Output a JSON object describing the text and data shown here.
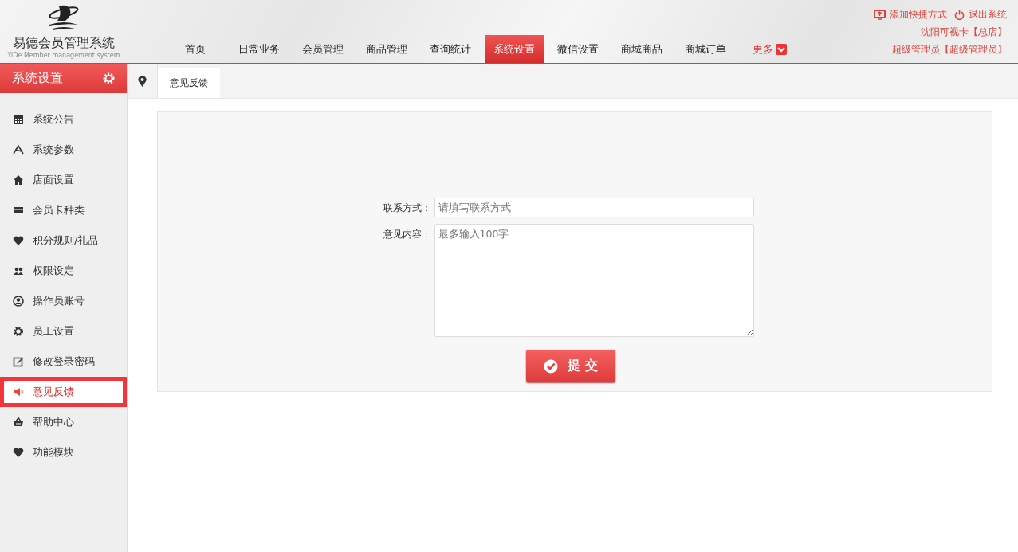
{
  "header": {
    "logo_title": "易德会员管理系统",
    "logo_subtitle": "YiDe Member management system",
    "nav": [
      {
        "label": "首页",
        "kind": "link",
        "selected": false
      },
      {
        "label": "日常业务",
        "kind": "link",
        "selected": false
      },
      {
        "label": "会员管理",
        "kind": "link",
        "selected": false
      },
      {
        "label": "商品管理",
        "kind": "link",
        "selected": false
      },
      {
        "label": "查询统计",
        "kind": "link",
        "selected": false
      },
      {
        "label": "系统设置",
        "kind": "link",
        "selected": true
      },
      {
        "label": "微信设置",
        "kind": "link",
        "selected": false
      },
      {
        "label": "商城商品",
        "kind": "link",
        "selected": false
      },
      {
        "label": "商城订单",
        "kind": "link",
        "selected": false
      },
      {
        "label": "更多",
        "kind": "more",
        "selected": false
      }
    ],
    "links": [
      {
        "label": "添加快捷方式",
        "kind": "shortcut"
      },
      {
        "label": "退出系统",
        "kind": "logout"
      }
    ],
    "shop": "沈阳可视卡【总店】",
    "user": "超级管理员【超级管理员】"
  },
  "sidebar": {
    "title": "系统设置",
    "items": [
      {
        "label": "系统公告",
        "selected": false
      },
      {
        "label": "系统参数",
        "selected": false
      },
      {
        "label": "店面设置",
        "selected": false
      },
      {
        "label": "会员卡种类",
        "selected": false
      },
      {
        "label": "积分规则/礼品",
        "selected": false
      },
      {
        "label": "权限设定",
        "selected": false
      },
      {
        "label": "操作员账号",
        "selected": false
      },
      {
        "label": "员工设置",
        "selected": false
      },
      {
        "label": "修改登录密码",
        "selected": false
      },
      {
        "label": "意见反馈",
        "selected": true
      },
      {
        "label": "帮助中心",
        "selected": false
      },
      {
        "label": "功能模块",
        "selected": false
      }
    ]
  },
  "tabs": [
    {
      "label": "意见反馈",
      "selected": true
    }
  ],
  "form": {
    "fields": [
      {
        "label": "联系方式：",
        "kind": "input",
        "placeholder": "请填写联系方式"
      },
      {
        "label": "意见内容：",
        "kind": "textarea",
        "placeholder": "最多输入100字"
      }
    ],
    "submit": "提 交"
  }
}
